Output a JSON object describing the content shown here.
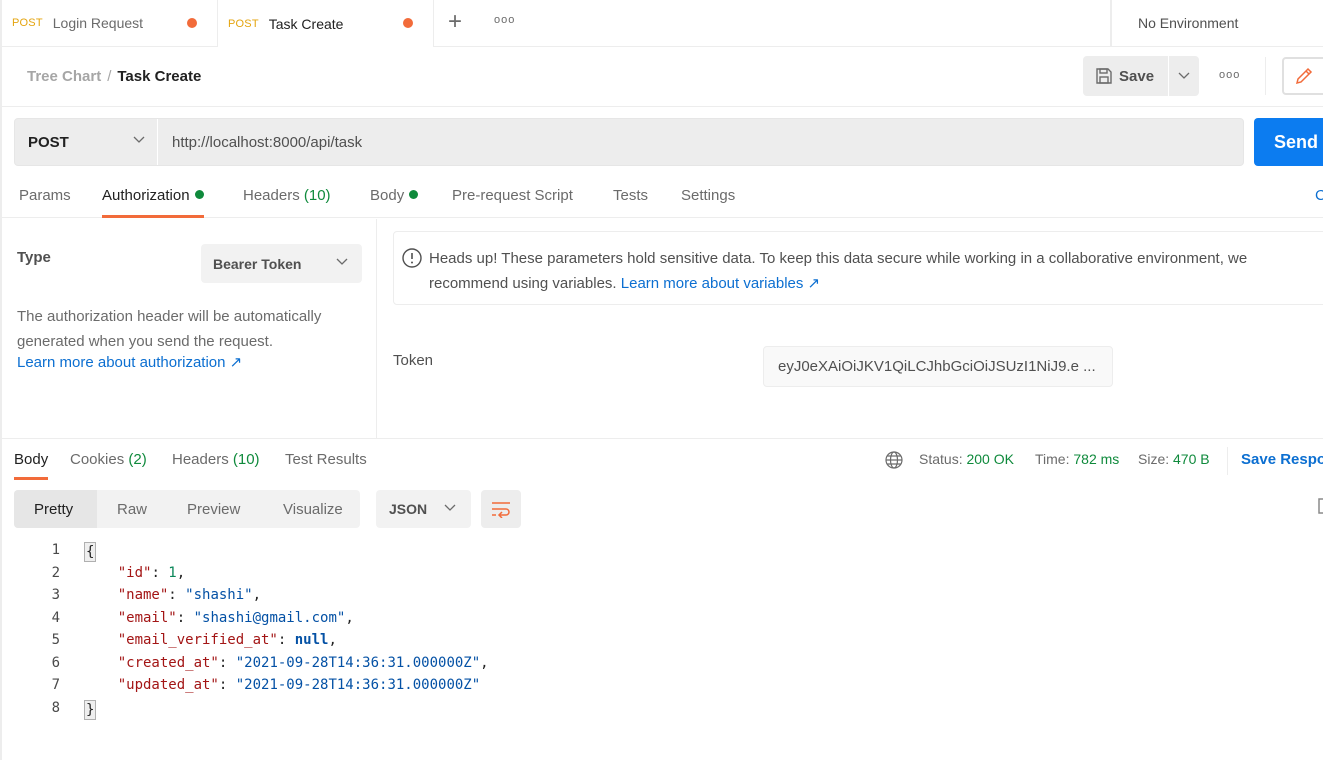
{
  "tabs": [
    {
      "method": "POST",
      "name": "Login Request",
      "unsaved": true,
      "active": false
    },
    {
      "method": "POST",
      "name": "Task Create",
      "unsaved": true,
      "active": true
    }
  ],
  "tabbar": {
    "new_tab_icon": "plus-icon",
    "more_icon": "ellipsis-icon"
  },
  "environment": {
    "selected": "No Environment"
  },
  "breadcrumb": {
    "parent": "Tree Chart",
    "separator": "/",
    "current": "Task Create"
  },
  "toolbar": {
    "save_label": "Save",
    "save_icon": "floppy-icon",
    "more_icon": "ellipsis-icon",
    "edit_icon": "pencil-icon"
  },
  "request": {
    "method": "POST",
    "url": "http://localhost:8000/api/task",
    "send_label": "Send",
    "tabs": [
      {
        "label": "Params"
      },
      {
        "label": "Authorization",
        "dot": true,
        "active": true
      },
      {
        "label": "Headers",
        "count": "(10)"
      },
      {
        "label": "Body",
        "dot": true
      },
      {
        "label": "Pre-request Script"
      },
      {
        "label": "Tests"
      },
      {
        "label": "Settings"
      }
    ],
    "cookies_link": "C"
  },
  "auth": {
    "type_label": "Type",
    "type_value": "Bearer Token",
    "description": "The authorization header will be automatically generated when you send the request.",
    "learn_more": "Learn more about authorization ↗",
    "notice_text": "Heads up! These parameters hold sensitive data. To keep this data secure while working in a collaborative environment, we recommend using variables.",
    "notice_link": "Learn more about variables ↗",
    "token_label": "Token",
    "token_value": "eyJ0eXAiOiJKV1QiLCJhbGciOiJSUzI1NiJ9.e ..."
  },
  "response": {
    "tabs": [
      {
        "label": "Body",
        "active": true
      },
      {
        "label": "Cookies",
        "count": "(2)"
      },
      {
        "label": "Headers",
        "count": "(10)"
      },
      {
        "label": "Test Results"
      }
    ],
    "status_label": "Status:",
    "status_value": "200 OK",
    "time_label": "Time:",
    "time_value": "782 ms",
    "size_label": "Size:",
    "size_value": "470 B",
    "save_label": "Save Respo",
    "views": [
      "Pretty",
      "Raw",
      "Preview",
      "Visualize"
    ],
    "active_view": "Pretty",
    "format": "JSON",
    "body_lines": [
      {
        "n": "1",
        "tokens": [
          {
            "t": "{",
            "c": "brace"
          }
        ]
      },
      {
        "n": "2",
        "tokens": [
          {
            "t": "    ",
            "c": "p"
          },
          {
            "t": "\"id\"",
            "c": "k"
          },
          {
            "t": ": ",
            "c": "p"
          },
          {
            "t": "1",
            "c": "n"
          },
          {
            "t": ",",
            "c": "p"
          }
        ]
      },
      {
        "n": "3",
        "tokens": [
          {
            "t": "    ",
            "c": "p"
          },
          {
            "t": "\"name\"",
            "c": "k"
          },
          {
            "t": ": ",
            "c": "p"
          },
          {
            "t": "\"shashi\"",
            "c": "s"
          },
          {
            "t": ",",
            "c": "p"
          }
        ]
      },
      {
        "n": "4",
        "tokens": [
          {
            "t": "    ",
            "c": "p"
          },
          {
            "t": "\"email\"",
            "c": "k"
          },
          {
            "t": ": ",
            "c": "p"
          },
          {
            "t": "\"shashi@gmail.com\"",
            "c": "s"
          },
          {
            "t": ",",
            "c": "p"
          }
        ]
      },
      {
        "n": "5",
        "tokens": [
          {
            "t": "    ",
            "c": "p"
          },
          {
            "t": "\"email_verified_at\"",
            "c": "k"
          },
          {
            "t": ": ",
            "c": "p"
          },
          {
            "t": "null",
            "c": "nl"
          },
          {
            "t": ",",
            "c": "p"
          }
        ]
      },
      {
        "n": "6",
        "tokens": [
          {
            "t": "    ",
            "c": "p"
          },
          {
            "t": "\"created_at\"",
            "c": "k"
          },
          {
            "t": ": ",
            "c": "p"
          },
          {
            "t": "\"2021-09-28T14:36:31.000000Z\"",
            "c": "s"
          },
          {
            "t": ",",
            "c": "p"
          }
        ]
      },
      {
        "n": "7",
        "tokens": [
          {
            "t": "    ",
            "c": "p"
          },
          {
            "t": "\"updated_at\"",
            "c": "k"
          },
          {
            "t": ": ",
            "c": "p"
          },
          {
            "t": "\"2021-09-28T14:36:31.000000Z\"",
            "c": "s"
          }
        ]
      },
      {
        "n": "8",
        "tokens": [
          {
            "t": "}",
            "c": "brace"
          }
        ]
      }
    ]
  },
  "colors": {
    "accent": "#f26b3a",
    "primary": "#0c7cf0",
    "method_post": "#e4a40f",
    "success": "#0f8a3c",
    "link": "#0c6fd1"
  }
}
